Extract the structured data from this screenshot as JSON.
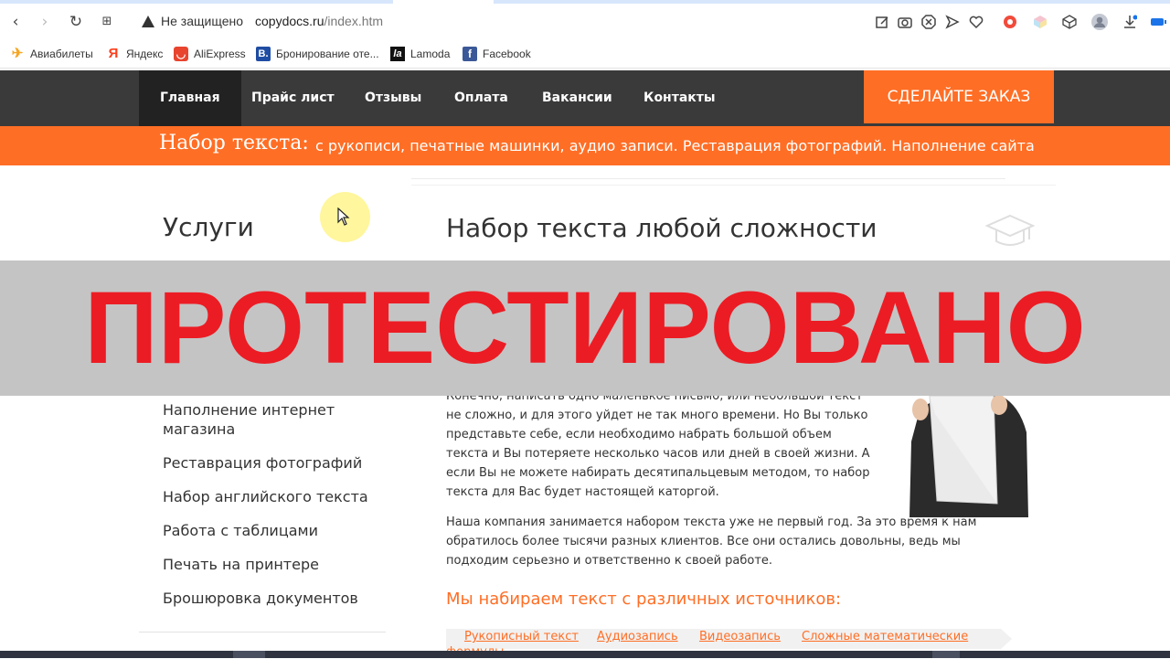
{
  "browser": {
    "warning_text": "Не защищено",
    "url_host": "copydocs.ru",
    "url_path": "/index.htm",
    "bookmarks": [
      {
        "label": "Авиабилеты",
        "icon": "plane-icon"
      },
      {
        "label": "Яндекс",
        "icon": "yandex-icon"
      },
      {
        "label": "AliExpress",
        "icon": "aliexpress-icon"
      },
      {
        "label": "Бронирование оте...",
        "icon": "booking-icon"
      },
      {
        "label": "Lamoda",
        "icon": "lamoda-icon"
      },
      {
        "label": "Facebook",
        "icon": "facebook-icon"
      }
    ]
  },
  "site_nav": {
    "items": [
      "Главная",
      "Прайс лист",
      "Отзывы",
      "Оплата",
      "Вакансии",
      "Контакты"
    ],
    "order_button": "СДЕЛАЙТЕ ЗАКАЗ"
  },
  "banner": {
    "title": "Набор текста:",
    "subtitle": "с рукописи, печатные машинки, аудио записи. Реставрация фотографий. Наполнение сайта"
  },
  "sidebar": {
    "title": "Услуги",
    "links": [
      "Наполнение интернет магазина",
      "Реставрация фотографий",
      "Набор английского текста",
      "Работа с таблицами",
      "Печать на принтере",
      "Брошюровка документов"
    ]
  },
  "main": {
    "title": "Набор текста любой сложности",
    "paragraph1": "Конечно, написать одно маленькое письмо, или небольшой текст не сложно, и для этого уйдет не так много времени. Но Вы только представьте себе, если необходимо набрать большой объем текста и Вы потеряете несколько часов или дней в своей жизни. А если Вы не можете набирать десятипальцевым методом, то набор текста для Вас будет настоящей каторгой.",
    "paragraph2": "Наша компания занимается набором текста уже не первый год. За это время к нам обратилось более тысячи разных клиентов. Все они остались довольны, ведь мы подходим серьезно и ответственно к своей работе.",
    "sources_title": "Мы набираем текст с различных источников:",
    "source_tabs": [
      "Рукописный текст",
      "Аудиозапись",
      "Видеозапись",
      "Сложные математические"
    ],
    "source_tab_cut": "формулы"
  },
  "stamp": {
    "text": "ПРОТЕСТИРОВАНО"
  },
  "colors": {
    "accent": "#ff6e25",
    "nav_bg": "#3a3a3a",
    "stamp_red": "#ec1c24",
    "stamp_bg": "#c4c4c4"
  }
}
